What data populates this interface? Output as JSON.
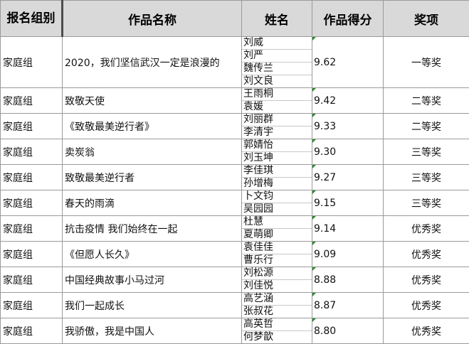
{
  "headers": {
    "group": "报名组别",
    "title": "作品名称",
    "name": "姓名",
    "score": "作品得分",
    "award": "奖项"
  },
  "rows": [
    {
      "group": "家庭组",
      "title": "2020，我们坚信武汉一定是浪漫的",
      "names": [
        "刘威",
        "刘严",
        "魏传兰",
        "刘文良"
      ],
      "score": "9.62",
      "award": "一等奖"
    },
    {
      "group": "家庭组",
      "title": "致敬天使",
      "names": [
        "王雨桐",
        "袁媛"
      ],
      "score": "9.42",
      "award": "二等奖"
    },
    {
      "group": "家庭组",
      "title": "《致敬最美逆行者》",
      "names": [
        "刘丽群",
        "李清宇"
      ],
      "score": "9.33",
      "award": "二等奖"
    },
    {
      "group": "家庭组",
      "title": "卖炭翁",
      "names": [
        "郭婧怡",
        "刘玉坤"
      ],
      "score": "9.30",
      "award": "三等奖"
    },
    {
      "group": "家庭组",
      "title": "致敬最美逆行者",
      "names": [
        "李佳琪",
        "孙增梅"
      ],
      "score": "9.27",
      "award": "三等奖"
    },
    {
      "group": "家庭组",
      "title": "春天的雨滴",
      "names": [
        "卜文钧",
        "吴园园"
      ],
      "score": "9.15",
      "award": "三等奖"
    },
    {
      "group": "家庭组",
      "title": "抗击疫情 我们始终在一起",
      "names": [
        "杜慧",
        "夏萌卿"
      ],
      "score": "9.14",
      "award": "优秀奖"
    },
    {
      "group": "家庭组",
      "title": "《但愿人长久》",
      "names": [
        "袁佳佳",
        "曹乐行"
      ],
      "score": "9.09",
      "award": "优秀奖"
    },
    {
      "group": "家庭组",
      "title": "中国经典故事小马过河",
      "names": [
        "刘松源",
        "刘佳悦"
      ],
      "score": "8.88",
      "award": "优秀奖"
    },
    {
      "group": "家庭组",
      "title": "我们一起成长",
      "names": [
        "高艺涵",
        "张叔花"
      ],
      "score": "8.87",
      "award": "优秀奖"
    },
    {
      "group": "家庭组",
      "title": "我骄傲，我是中国人",
      "names": [
        "高英哲",
        "何梦歆"
      ],
      "score": "8.80",
      "award": "优秀奖"
    }
  ]
}
